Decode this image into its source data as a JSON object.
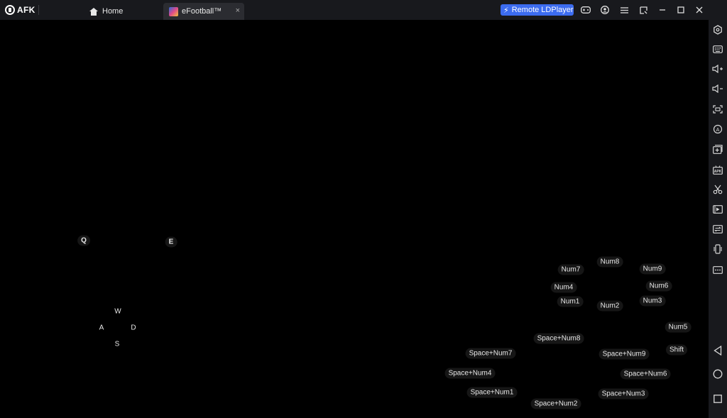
{
  "titlebar": {
    "logo_text": "AFK",
    "tabs": [
      {
        "label": "Home"
      },
      {
        "label": "eFootball™"
      }
    ],
    "tab_close": "×",
    "remote_button": "Remote LDPlayer",
    "icons": [
      "gamepad-icon",
      "account-icon",
      "menu-icon",
      "window-icon",
      "minimize-icon",
      "maximize-icon",
      "close-icon"
    ]
  },
  "sidebar": {
    "icons": [
      "settings-icon",
      "keyboard-icon",
      "volume-up-icon",
      "volume-down-icon",
      "screenshot-icon",
      "sync-icon",
      "add-apk-icon",
      "apk-icon",
      "scissors-icon",
      "record-icon",
      "operations-icon",
      "shake-icon",
      "more-icon",
      "back-icon",
      "home-circle-icon",
      "recent-apps-icon"
    ]
  },
  "keymap": {
    "q": "Q",
    "e": "E",
    "w": "W",
    "a": "A",
    "s": "S",
    "d": "D",
    "num8": "Num8",
    "num7": "Num7",
    "num9": "Num9",
    "num4": "Num4",
    "num6": "Num6",
    "num1": "Num1",
    "num2": "Num2",
    "num3": "Num3",
    "num5": "Num5",
    "shift": "Shift",
    "space_num8": "Space+Num8",
    "space_num7": "Space+Num7",
    "space_num9": "Space+Num9",
    "space_num4": "Space+Num4",
    "space_num6": "Space+Num6",
    "space_num1": "Space+Num1",
    "space_num3": "Space+Num3",
    "space_num2": "Space+Num2"
  }
}
